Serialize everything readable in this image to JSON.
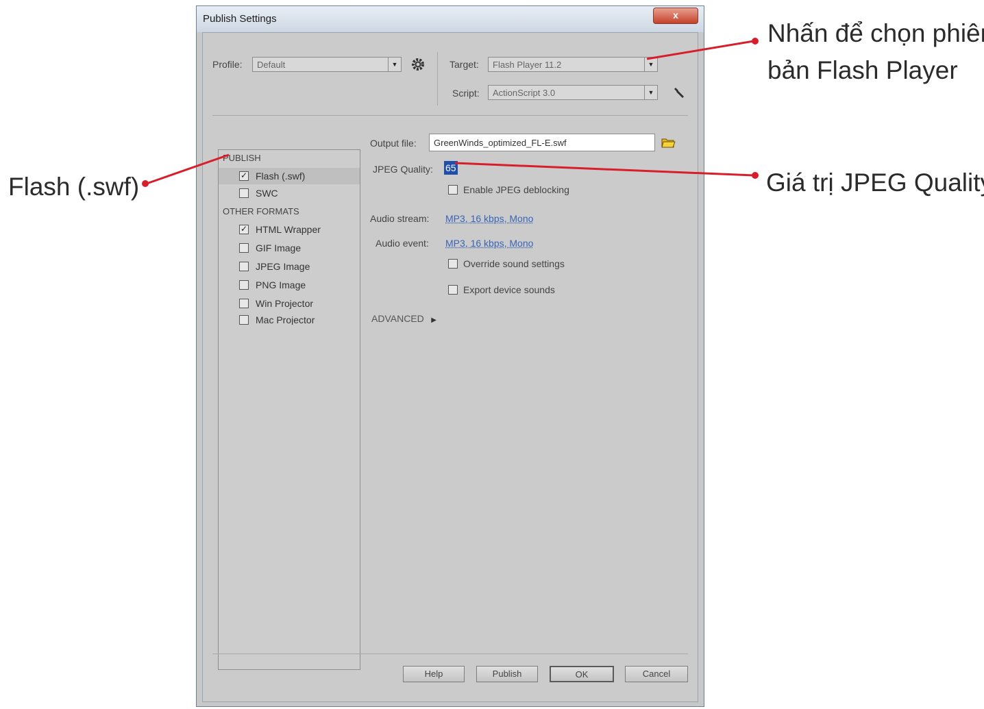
{
  "dialog": {
    "title": "Publish Settings",
    "close_label": "x"
  },
  "top": {
    "profile_label": "Profile:",
    "profile_value": "Default",
    "target_label": "Target:",
    "target_value": "Flash Player 11.2",
    "script_label": "Script:",
    "script_value": "ActionScript 3.0"
  },
  "formats": {
    "publish_header": "PUBLISH",
    "publish_items": [
      {
        "label": "Flash (.swf)",
        "checked": true
      },
      {
        "label": "SWC",
        "checked": false
      }
    ],
    "other_header": "OTHER FORMATS",
    "other_items": [
      {
        "label": "HTML Wrapper",
        "checked": true
      },
      {
        "label": "GIF Image",
        "checked": false
      },
      {
        "label": "JPEG Image",
        "checked": false
      },
      {
        "label": "PNG Image",
        "checked": false
      },
      {
        "label": "Win Projector",
        "checked": false
      },
      {
        "label": "Mac Projector",
        "checked": false
      }
    ]
  },
  "settings": {
    "output_file_label": "Output file:",
    "output_file_value": "GreenWinds_optimized_FL-E.swf",
    "jpeg_quality_label": "JPEG Quality:",
    "jpeg_quality_value": "65",
    "enable_deblocking_label": "Enable JPEG deblocking",
    "audio_stream_label": "Audio stream:",
    "audio_stream_value": "MP3, 16 kbps, Mono",
    "audio_event_label": "Audio event:",
    "audio_event_value": "MP3, 16 kbps, Mono",
    "override_sound_label": "Override sound settings",
    "export_device_sounds_label": "Export device sounds",
    "advanced_label": "ADVANCED"
  },
  "buttons": {
    "help": "Help",
    "publish": "Publish",
    "ok": "OK",
    "cancel": "Cancel"
  },
  "callouts": {
    "target_line1": "Nhấn để chọn phiên",
    "target_line2": "bản Flash Player",
    "jpeg": "Giá trị JPEG Quality",
    "flash": "Flash (.swf)"
  },
  "colors": {
    "callout_line": "#d81e2a",
    "highlight": "#1f4fa8"
  }
}
